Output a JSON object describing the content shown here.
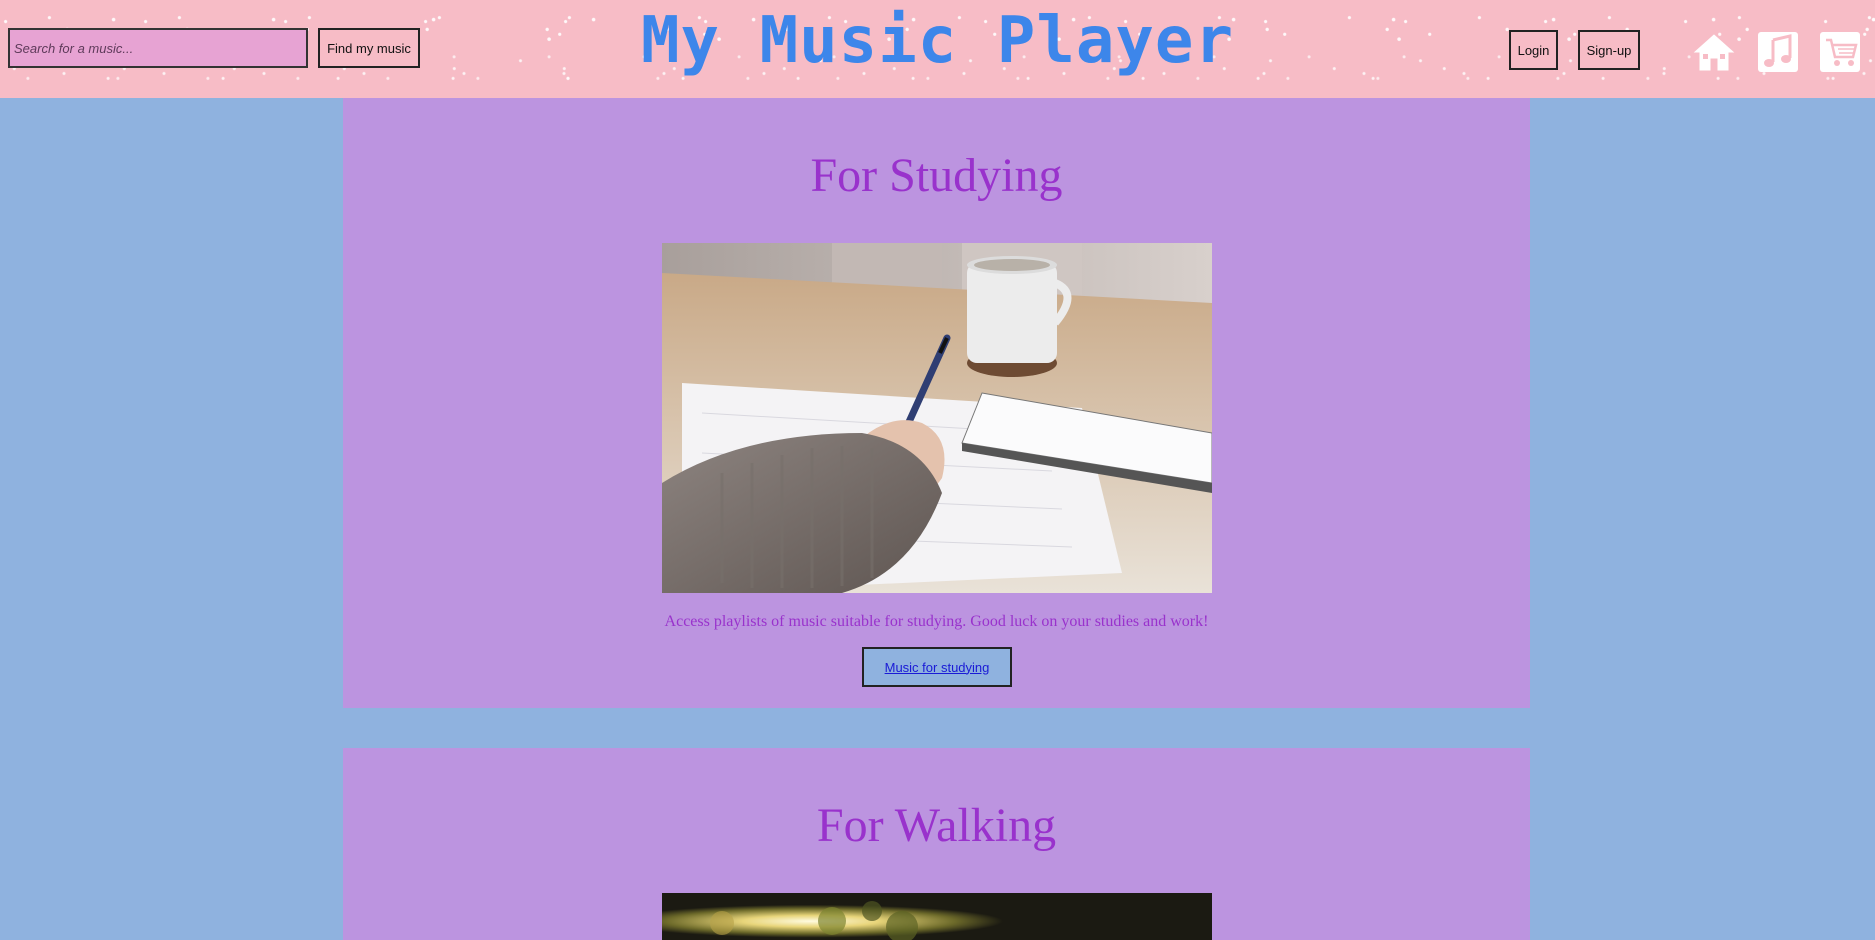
{
  "header": {
    "title": "My Music Player",
    "search": {
      "placeholder": "Search for a music...",
      "value": ""
    },
    "find_button": "Find my music",
    "login_button": "Login",
    "signup_button": "Sign-up",
    "icons": [
      "home-icon",
      "music-note-icon",
      "shopping-cart-icon"
    ]
  },
  "sections": [
    {
      "title": "For Studying",
      "image": "photo of a person writing in a notebook with a pen, coffee cup on a wooden table",
      "description": "Access playlists of music suitable for studying. Good luck on your studies and work!",
      "link_label": "Music for studying"
    },
    {
      "title": "For Walking",
      "image": "sunlit trees photo (partially visible)"
    }
  ],
  "colors": {
    "background": "#8fb2df",
    "header": "#f7bcc6",
    "card": "#bc94e0",
    "title_text": "#3d86ea",
    "card_text": "#9932cc"
  }
}
